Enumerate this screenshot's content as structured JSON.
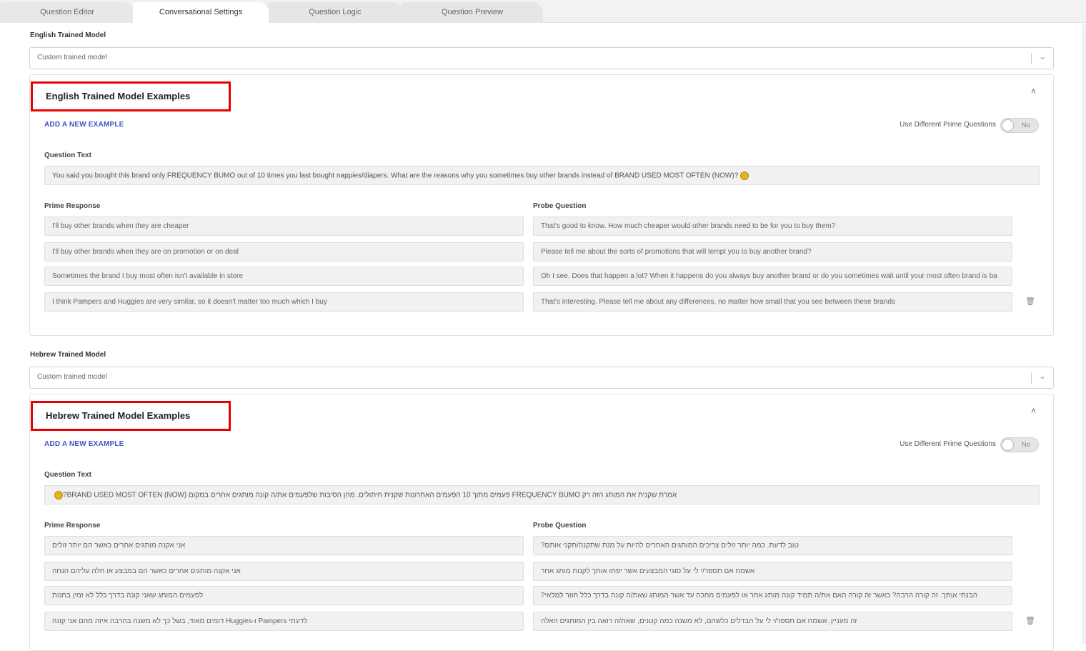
{
  "tabs": [
    {
      "label": "Question Editor",
      "active": false
    },
    {
      "label": "Conversational Settings",
      "active": true
    },
    {
      "label": "Question Logic",
      "active": false
    },
    {
      "label": "Question Preview",
      "active": false
    }
  ],
  "english": {
    "model_label": "English Trained Model",
    "model_value": "Custom trained model",
    "card_title": "English Trained Model Examples",
    "add_example": "ADD A NEW EXAMPLE",
    "prime_toggle_label": "Use Different Prime Questions",
    "toggle_state": "No",
    "question_text_label": "Question Text",
    "question_text": "You said you bought this brand only FREQUENCY BUMO out of 10 times you last bought nappies/diapers. What are the reasons why you sometimes buy other brands instead of BRAND USED MOST OFTEN (NOW)?",
    "prime_label": "Prime Response",
    "probe_label": "Probe Question",
    "rows": [
      {
        "prime": "I'll buy other brands when they are cheaper",
        "probe": "That's good to know. How much cheaper would other brands need to be for you to buy them?"
      },
      {
        "prime": "I'll buy other brands when they are on promotion or on deal",
        "probe": "Please tell me about the sorts of promotions that will tempt you to buy another brand?"
      },
      {
        "prime": "Sometimes the brand I buy most often isn't available in store",
        "probe": "Oh I see. Does that happen a lot? When it happens do you always buy another brand or do you sometimes wait until your most often brand is ba"
      },
      {
        "prime": "I think Pampers and Huggies are very similar, so it doesn't matter too much which I buy",
        "probe": "That's interesting. Please tell me about any differences, no matter how small that you see between these brands"
      }
    ]
  },
  "hebrew": {
    "model_label": "Hebrew Trained Model",
    "model_value": "Custom trained model",
    "card_title": "Hebrew Trained Model Examples",
    "add_example": "ADD A NEW EXAMPLE",
    "prime_toggle_label": "Use Different Prime Questions",
    "toggle_state": "No",
    "question_text_label": "Question Text",
    "question_text": "אמרת שקנית את המותג הזה רק FREQUENCY BUMO פעמים מתוך 10 הפעמים האחרונות שקנית חיתולים. מהן הסיבות שלפעמים את/ה קונה מותגים אחרים במקום BRAND USED MOST OFTEN (NOW)?",
    "prime_label": "Prime Response",
    "probe_label": "Probe Question",
    "rows": [
      {
        "prime": "אני אקנה מותגים אחרים כאשר הם יותר זולים",
        "probe": "טוב לדעת. כמה יותר זולים צריכים המותגים האחרים להיות על מנת שתקנה/תקני אותם?"
      },
      {
        "prime": "אני אקנה מותגים אחרים כאשר הם במבצע או חלה עליהם הנחה",
        "probe": "אשמח אם תספר/י לי על סוגי המבצעים אשר יפתו אותך לקנות מותג אחר"
      },
      {
        "prime": "לפעמים המותג שאני קונה בדרך כלל לא זמין בחנות",
        "probe": "הבנתי אותך. זה קורה הרבה? כאשר זה קורה האם את/ה תמיד קונה מותג אחר או לפעמים מחכה עד אשר המותג שאת/ה קונה בדרך כלל חוזר למלאי?"
      },
      {
        "prime": "לדעתי Pampers ו-Huggies דומים מאוד, בשל כך לא משנה בהרבה איזה מהם אני קונה",
        "probe": "זה מעניין. אשמח אם תספר/י לי על הבדלים כלשהם, לא משנה כמה קטנים, שאת/ה רואה בין המותגים האלה"
      }
    ]
  },
  "icons": {
    "collapse": "chevron-up-icon",
    "trash": "trash-icon",
    "emoji": "emoji-icon",
    "dropdown": "chevron-down-icon"
  }
}
